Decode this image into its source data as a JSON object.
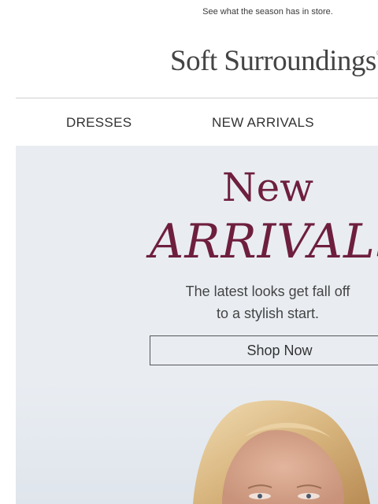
{
  "preheader": {
    "text": "See what the season has in store."
  },
  "brand": {
    "name": "Soft Surroundings",
    "reg_mark": "®"
  },
  "nav": {
    "items": [
      {
        "label": "DRESSES"
      },
      {
        "label": "NEW ARRIVALS"
      }
    ]
  },
  "hero": {
    "headline_1": "New",
    "headline_2": "ARRIVALS",
    "subline_1": "The latest looks get fall off",
    "subline_2": "to a stylish start.",
    "cta_label": "Shop Now"
  },
  "colors": {
    "accent": "#6e1f3d",
    "hero_bg": "#e9edf2"
  }
}
